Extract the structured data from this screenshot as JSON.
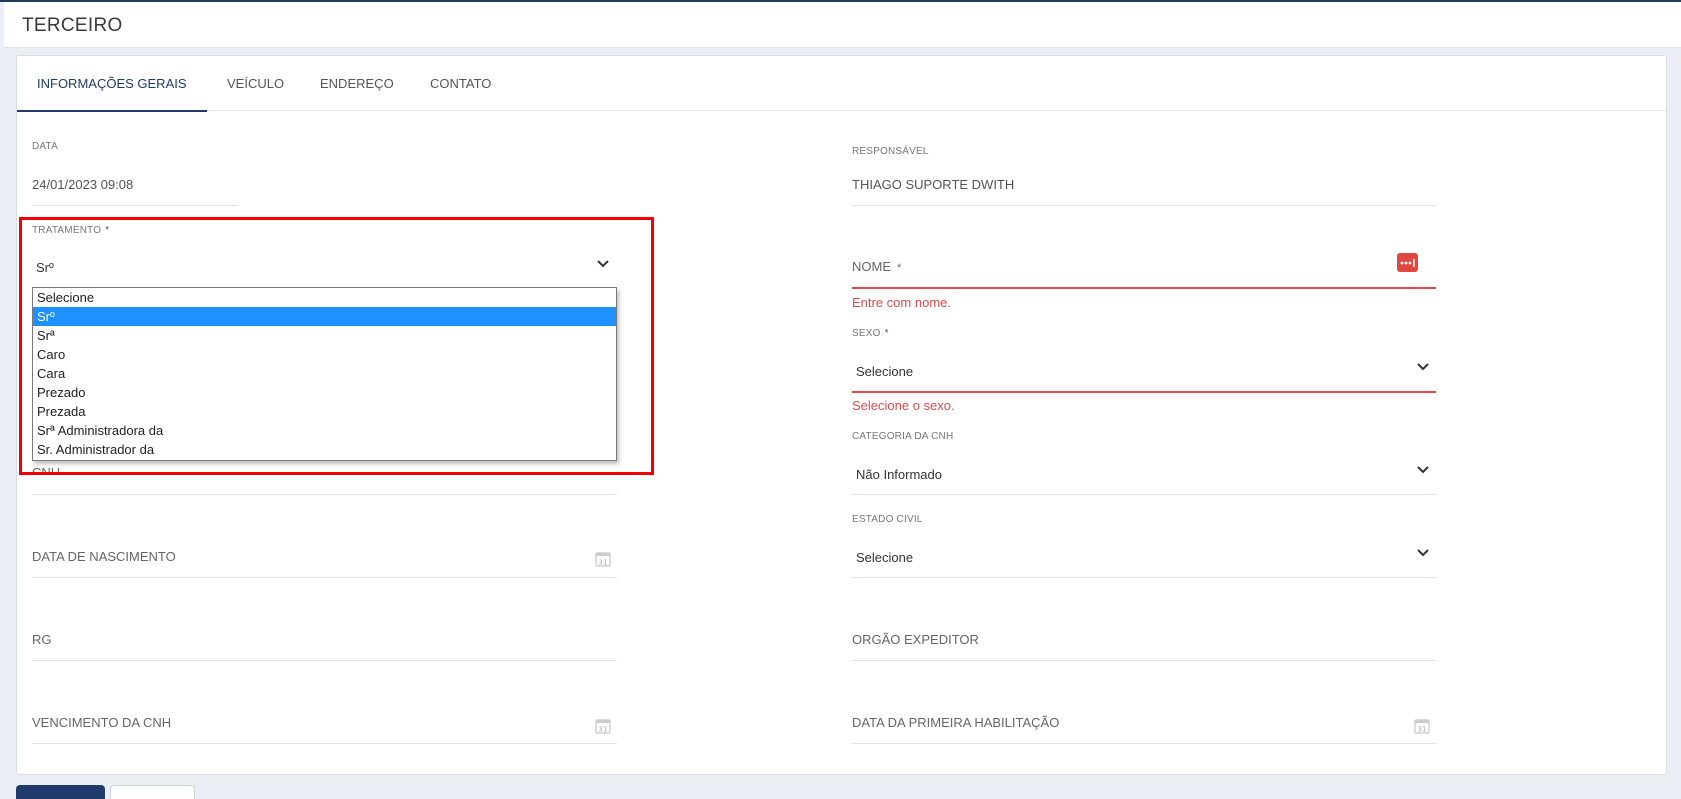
{
  "page": {
    "title": "TERCEIRO"
  },
  "tabs": [
    {
      "label": "INFORMAÇÕES GERAIS",
      "active": true
    },
    {
      "label": "VEÍCULO"
    },
    {
      "label": "ENDEREÇO"
    },
    {
      "label": "CONTATO"
    }
  ],
  "form": {
    "data": {
      "label": "DATA",
      "value": "24/01/2023 09:08"
    },
    "responsavel": {
      "label": "RESPONSÁVEL",
      "value": "THIAGO SUPORTE DWITH"
    },
    "tratamento": {
      "label": "TRATAMENTO",
      "required_mark": "*",
      "value": "Srº",
      "options": [
        "Selecione",
        "Srº",
        "Srª",
        "Caro",
        "Cara",
        "Prezado",
        "Prezada",
        "Srª Administradora da",
        "Sr. Administrador da"
      ],
      "selected_index": 1
    },
    "nome": {
      "placeholder": "NOME",
      "required_mark": "*",
      "error": "Entre com nome."
    },
    "sexo": {
      "label": "SEXO",
      "required_mark": "*",
      "value": "Selecione",
      "error": "Selecione o sexo."
    },
    "cnh": {
      "placeholder": "CNH"
    },
    "categoria_cnh": {
      "label": "CATEGORIA DA CNH",
      "value": "Não Informado"
    },
    "data_nascimento": {
      "placeholder": "DATA DE NASCIMENTO"
    },
    "estado_civil": {
      "label": "ESTADO CIVIL",
      "value": "Selecione"
    },
    "rg": {
      "placeholder": "RG"
    },
    "orgao_expeditor": {
      "placeholder": "ORGÃO EXPEDITOR"
    },
    "vencimento_cnh": {
      "placeholder": "VENCIMENTO DA CNH"
    },
    "data_primeira_habilitacao": {
      "placeholder": "DATA DA PRIMEIRA HABILITAÇÃO"
    },
    "calendar_day": "31"
  },
  "icons": {
    "chevron": "chevron-down-icon",
    "calendar": "calendar-icon",
    "password_manager": "password-manager-icon"
  },
  "colors": {
    "primary": "#1f3a6b",
    "error": "#e24a4a",
    "highlight": "#f40000",
    "option_selected": "#1e90ff"
  }
}
